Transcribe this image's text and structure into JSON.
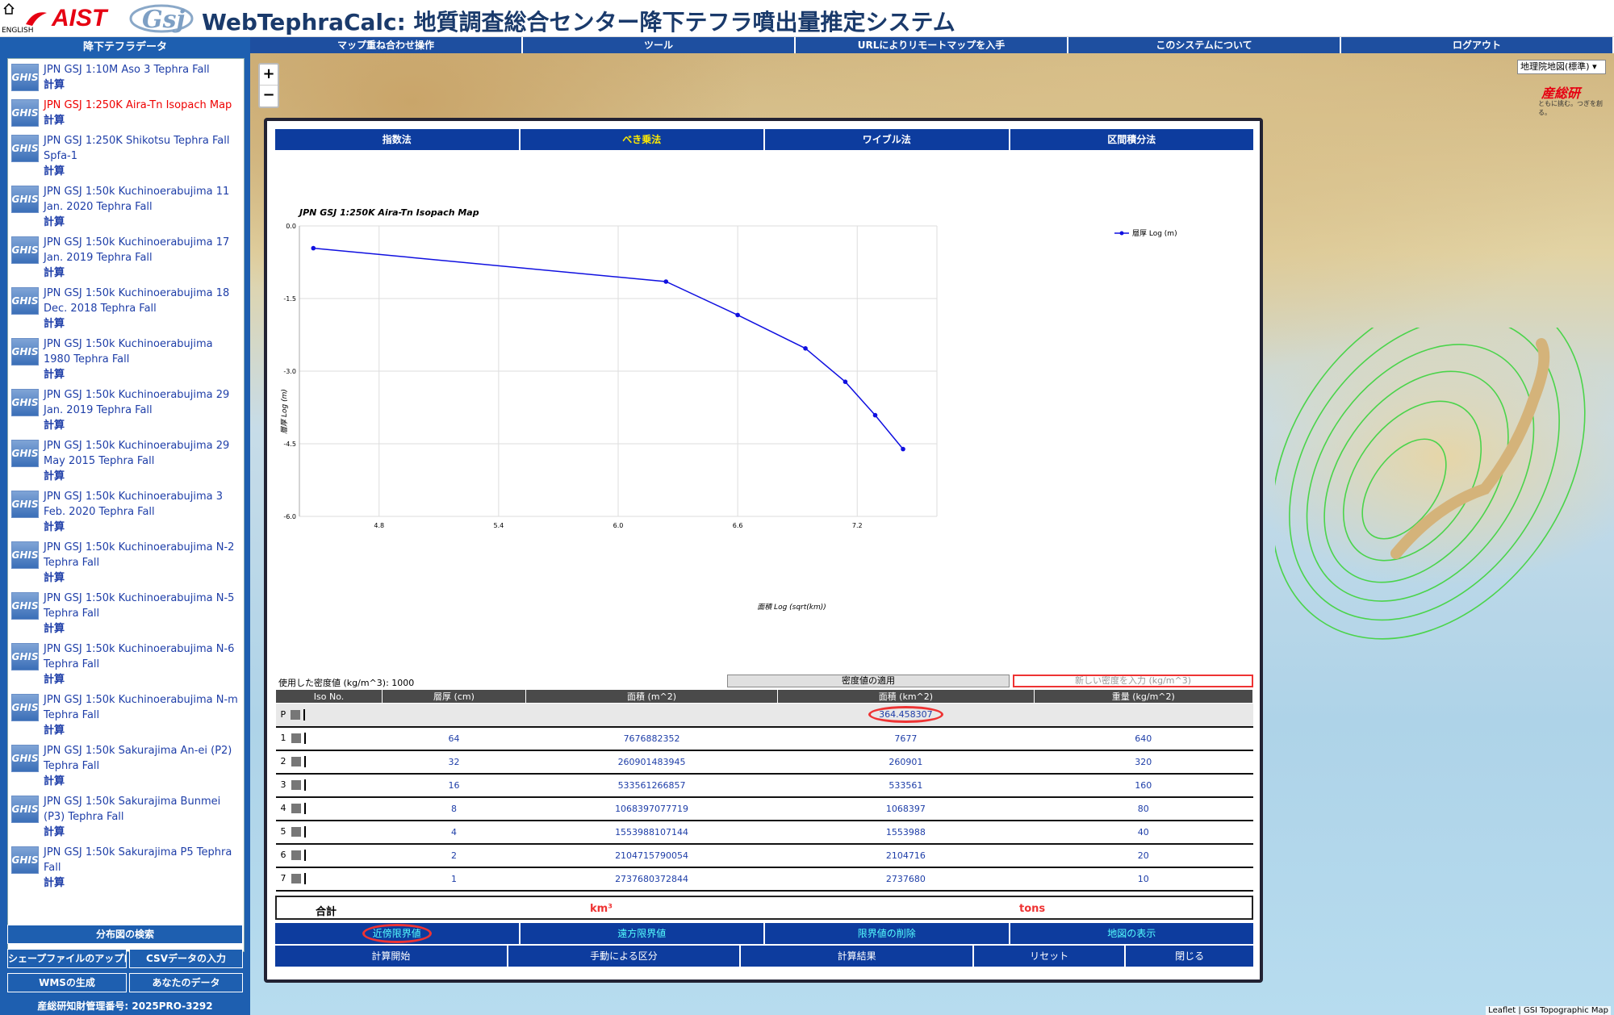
{
  "header": {
    "english": "ENGLISH",
    "aist": "AIST",
    "title": "WebTephraCalc: 地質調査総合センター降下テフラ噴出量推定システム"
  },
  "sidebar": {
    "title": "降下テフラデータ",
    "calc_label": "計算",
    "items": [
      {
        "name": "JPN GSJ 1:10M Aso 3 Tephra Fall"
      },
      {
        "name": "JPN GSJ 1:250K Aira-Tn Isopach Map"
      },
      {
        "name": "JPN GSJ 1:250K Shikotsu Tephra Fall Spfa-1"
      },
      {
        "name": "JPN GSJ 1:50k Kuchinoerabujima 11 Jan. 2020 Tephra Fall"
      },
      {
        "name": "JPN GSJ 1:50k Kuchinoerabujima 17 Jan. 2019 Tephra Fall"
      },
      {
        "name": "JPN GSJ 1:50k Kuchinoerabujima 18 Dec. 2018 Tephra Fall"
      },
      {
        "name": "JPN GSJ 1:50k Kuchinoerabujima 1980 Tephra Fall"
      },
      {
        "name": "JPN GSJ 1:50k Kuchinoerabujima 29 Jan. 2019 Tephra Fall"
      },
      {
        "name": "JPN GSJ 1:50k Kuchinoerabujima 29 May 2015 Tephra Fall"
      },
      {
        "name": "JPN GSJ 1:50k Kuchinoerabujima 3 Feb. 2020 Tephra Fall"
      },
      {
        "name": "JPN GSJ 1:50k Kuchinoerabujima N-2 Tephra Fall"
      },
      {
        "name": "JPN GSJ 1:50k Kuchinoerabujima N-5 Tephra Fall"
      },
      {
        "name": "JPN GSJ 1:50k Kuchinoerabujima N-6 Tephra Fall"
      },
      {
        "name": "JPN GSJ 1:50k Kuchinoerabujima N-m Tephra Fall"
      },
      {
        "name": "JPN GSJ 1:50k Sakurajima An-ei (P2) Tephra Fall"
      },
      {
        "name": "JPN GSJ 1:50k Sakurajima Bunmei (P3) Tephra Fall"
      },
      {
        "name": "JPN GSJ 1:50k Sakurajima P5 Tephra Fall"
      }
    ],
    "search_button": "分布図の検索",
    "shapefile_button": "シェープファイルのアップロード",
    "csv_button": "CSVデータの入力",
    "wms_button": "WMSの生成",
    "your_data_button": "あなたのデータ",
    "footer": "産総研知財管理番号: 2025PRO-3292"
  },
  "topnav": [
    "マップ重ね合わせ操作",
    "ツール",
    "URLによりリモートマップを入手",
    "このシステムについて",
    "ログアウト"
  ],
  "map": {
    "zoom_in": "+",
    "zoom_out": "−",
    "layer": "地理院地図(標準)",
    "corner_logo": "産総研",
    "corner_sub": "ともに挑む。つぎを創る。",
    "attribution": "Leaflet | GSI Topographic Map"
  },
  "dialog": {
    "methods": [
      "指数法",
      "べき乗法",
      "ワイブル法",
      "区間積分法"
    ],
    "selected_method": "べき乗法",
    "density_label": "使用した密度値 (kg/m^3): 1000",
    "density_apply": "密度値の適用",
    "density_placeholder": "新しい密度を入力 (kg/m^3)",
    "table_headers": [
      "Iso No.",
      "層厚 (cm)",
      "面積 (m^2)",
      "面積 (km^2)",
      "重量 (kg/m^2)"
    ],
    "p_row": {
      "iso": "P",
      "area_km2": "364.458307"
    },
    "rows": [
      {
        "iso": "1",
        "thickness": "64",
        "area_m2": "7676882352",
        "area_km2": "7677",
        "weight": "640"
      },
      {
        "iso": "2",
        "thickness": "32",
        "area_m2": "260901483945",
        "area_km2": "260901",
        "weight": "320"
      },
      {
        "iso": "3",
        "thickness": "16",
        "area_m2": "533561266857",
        "area_km2": "533561",
        "weight": "160"
      },
      {
        "iso": "4",
        "thickness": "8",
        "area_m2": "1068397077719",
        "area_km2": "1068397",
        "weight": "80"
      },
      {
        "iso": "5",
        "thickness": "4",
        "area_m2": "1553988107144",
        "area_km2": "1553988",
        "weight": "40"
      },
      {
        "iso": "6",
        "thickness": "2",
        "area_m2": "2104715790054",
        "area_km2": "2104716",
        "weight": "20"
      },
      {
        "iso": "7",
        "thickness": "1",
        "area_m2": "2737680372844",
        "area_km2": "2737680",
        "weight": "10"
      }
    ],
    "total_label": "合計",
    "total_unit_volume": "km³",
    "total_unit_mass": "tons",
    "limit_buttons": [
      "近傍限界値",
      "遠方限界値",
      "限界値の削除",
      "地図の表示"
    ],
    "action_buttons": [
      "計算開始",
      "手動による区分",
      "計算結果",
      "リセット",
      "閉じる"
    ]
  },
  "chart_data": {
    "type": "line",
    "title": "JPN GSJ 1:250K Aira-Tn Isopach Map",
    "xlabel": "面積 Log (sqrt(km))",
    "ylabel": "層厚 Log (m)",
    "xlim": [
      4.4,
      7.6
    ],
    "ylim": [
      -6.0,
      0.0
    ],
    "x_ticks": [
      "4.8",
      "5.4",
      "6.0",
      "6.6",
      "7.2"
    ],
    "y_ticks": [
      "0.0",
      "-1.5",
      "-3.0",
      "-4.5",
      "-6.0"
    ],
    "legend_position": "top-right",
    "color": "#1010e0",
    "series": [
      {
        "name": "層厚 Log (m)",
        "x": [
          4.47,
          6.24,
          6.6,
          6.94,
          7.14,
          7.29,
          7.43
        ],
        "y": [
          -0.46,
          -1.15,
          -1.84,
          -2.53,
          -3.22,
          -3.91,
          -4.61
        ]
      }
    ]
  }
}
